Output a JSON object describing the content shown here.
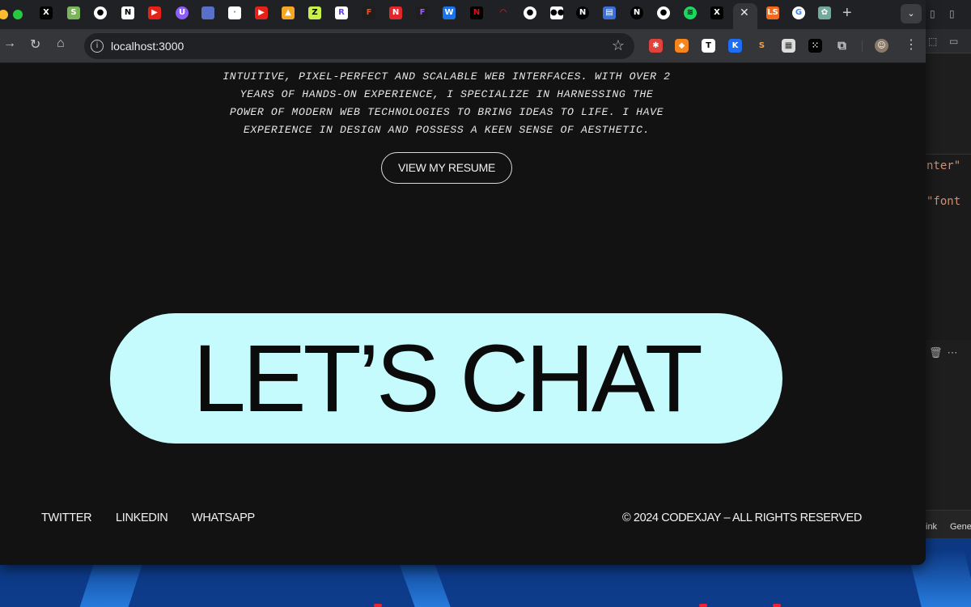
{
  "browser": {
    "url": "localhost:3000",
    "tab_icons": [
      "x-icon",
      "shopify-icon",
      "github-icon",
      "notion-icon",
      "youtube-icon",
      "proton-icon",
      "app-icon",
      "blank-page-icon",
      "youtube-icon",
      "firebase-icon",
      "z-icon",
      "r-icon",
      "figma-icon",
      "n-icon",
      "figma-icon",
      "w-icon",
      "netflix-icon",
      "speed-icon",
      "github-icon",
      "medium-icon",
      "n-icon",
      "store-icon",
      "n-icon",
      "github-icon",
      "spotify-icon",
      "x-icon",
      "ls-icon",
      "google-icon",
      "chatgpt-icon"
    ],
    "extension_icons": [
      "bug-icon",
      "metamask-icon",
      "t-icon",
      "k-icon",
      "s-icon",
      "grid-icon",
      "puzzle-icon",
      "avatar-icon",
      "menu-icon"
    ]
  },
  "page": {
    "bio": "INTUITIVE, PIXEL-PERFECT AND SCALABLE WEB INTERFACES. WITH OVER 2 YEARS OF HANDS-ON EXPERIENCE, I SPECIALIZE IN HARNESSING THE POWER OF MODERN WEB TECHNOLOGIES TO BRING IDEAS TO LIFE. I HAVE EXPERIENCE IN DESIGN AND POSSESS A KEEN SENSE OF AESTHETIC.",
    "resume_label": "VIEW MY RESUME",
    "cta_label": "LET’S CHAT",
    "cta_color": "#c5fbfc",
    "background_color": "#121212"
  },
  "footer": {
    "links": [
      "TWITTER",
      "LINKEDIN",
      "WHATSAPP"
    ],
    "copyright": "© 2024 CODEXJAY – ALL RIGHTS RESERVED"
  },
  "editor": {
    "code_line_1": "nter\"",
    "code_line_2": "\"font",
    "status_left": "ink",
    "status_right": "Gene"
  }
}
